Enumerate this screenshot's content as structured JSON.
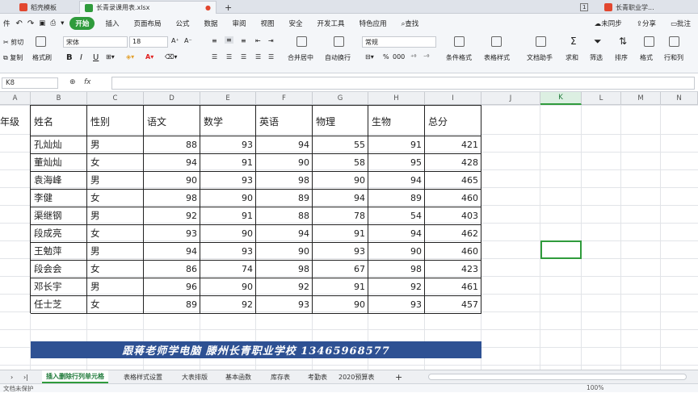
{
  "tabs": [
    {
      "label": "稻壳模板",
      "color": "#e2472f",
      "active": false
    },
    {
      "label": "长青录课用表.xlsx",
      "color": "#2f9b3c",
      "active": true
    },
    {
      "label": "长青职业学...",
      "color": "#e2472f",
      "active": false
    }
  ],
  "tab_counter": "1",
  "menu": {
    "file_partial": "件",
    "start": "开始",
    "items": [
      "插入",
      "页面布局",
      "公式",
      "数据",
      "审阅",
      "视图",
      "安全",
      "开发工具",
      "特色应用"
    ],
    "search": "查找",
    "sync": "未同步",
    "share": "分享",
    "comment": "批注"
  },
  "ribbon": {
    "cut": "剪切",
    "copy": "复制",
    "format_painter": "格式刷",
    "font_name": "宋体",
    "font_size": "18",
    "bold": "B",
    "italic": "I",
    "underline": "U",
    "merge_center": "合并居中",
    "auto_wrap": "自动换行",
    "number_format": "常规",
    "percent": "%",
    "thousands": "000",
    "conditional_format": "条件格式",
    "table_style": "表格样式",
    "doc_helper": "文档助手",
    "sum": "求和",
    "filter": "筛选",
    "sort": "排序",
    "format": "格式",
    "rows_cols": "行和列"
  },
  "formula_bar": {
    "cell_ref": "K8",
    "fx": "fx",
    "content": ""
  },
  "columns": [
    "A",
    "B",
    "C",
    "D",
    "E",
    "F",
    "G",
    "H",
    "I",
    "J",
    "K",
    "L",
    "M",
    "N"
  ],
  "selected_column": "K",
  "table": {
    "headers": [
      "年级",
      "姓名",
      "性别",
      "语文",
      "数学",
      "英语",
      "物理",
      "生物",
      "总分"
    ],
    "rows": [
      [
        "孔灿灿",
        "男",
        "88",
        "93",
        "94",
        "55",
        "91",
        "421"
      ],
      [
        "董灿灿",
        "女",
        "94",
        "91",
        "90",
        "58",
        "95",
        "428"
      ],
      [
        "袁海峰",
        "男",
        "90",
        "93",
        "98",
        "90",
        "94",
        "465"
      ],
      [
        "李健",
        "女",
        "98",
        "90",
        "89",
        "94",
        "89",
        "460"
      ],
      [
        "渠继钢",
        "男",
        "92",
        "91",
        "88",
        "78",
        "54",
        "403"
      ],
      [
        "段成亮",
        "女",
        "93",
        "90",
        "94",
        "91",
        "94",
        "462"
      ],
      [
        "王勉萍",
        "男",
        "94",
        "93",
        "90",
        "93",
        "90",
        "460"
      ],
      [
        "段会会",
        "女",
        "86",
        "74",
        "98",
        "67",
        "98",
        "423"
      ],
      [
        "邓长宇",
        "男",
        "96",
        "90",
        "92",
        "91",
        "92",
        "461"
      ],
      [
        "任士芝",
        "女",
        "89",
        "92",
        "93",
        "90",
        "93",
        "457"
      ]
    ]
  },
  "banner": "跟蒋老师学电脑 滕州长青职业学校 13465968577",
  "banner_color": "#2e5193",
  "accent_color": "#2f9b3c",
  "sheet_tabs": [
    "插入删除行列单元格",
    "表格样式设置",
    "大表排版",
    "基本函数",
    "库存表",
    "考勤表",
    "2020预算表"
  ],
  "active_sheet": "插入删除行列单元格",
  "status": {
    "left": "文档未保护",
    "zoom": "100%"
  }
}
